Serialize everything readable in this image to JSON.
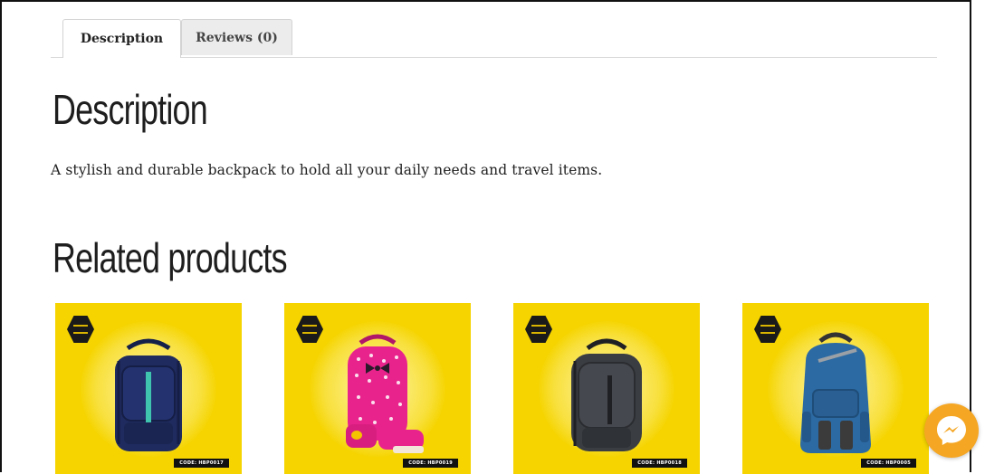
{
  "tabs": [
    {
      "label": "Description",
      "active": true
    },
    {
      "label": "Reviews (0)",
      "active": false
    }
  ],
  "description": {
    "heading": "Description",
    "text": "A stylish and durable backpack to hold all your daily needs and travel items."
  },
  "related": {
    "heading": "Related products",
    "products": [
      {
        "code": "CODE: HBP0017",
        "bag_color": "#1f2b5e",
        "accent": "#3fc4b0"
      },
      {
        "code": "CODE: HBP0019",
        "bag_color": "#e8248c",
        "accent": "#2a1a2a"
      },
      {
        "code": "CODE: HBP0018",
        "bag_color": "#3a3d42",
        "accent": "#1f2024"
      },
      {
        "code": "CODE: HBP0005",
        "bag_color": "#2c6aa3",
        "accent": "#3b3b3b"
      }
    ]
  },
  "colors": {
    "card_background": "#f5d400",
    "messenger_button": "#f5a623"
  },
  "icons": {
    "brand_badge": "brand-badge-icon",
    "messenger": "messenger-icon"
  }
}
